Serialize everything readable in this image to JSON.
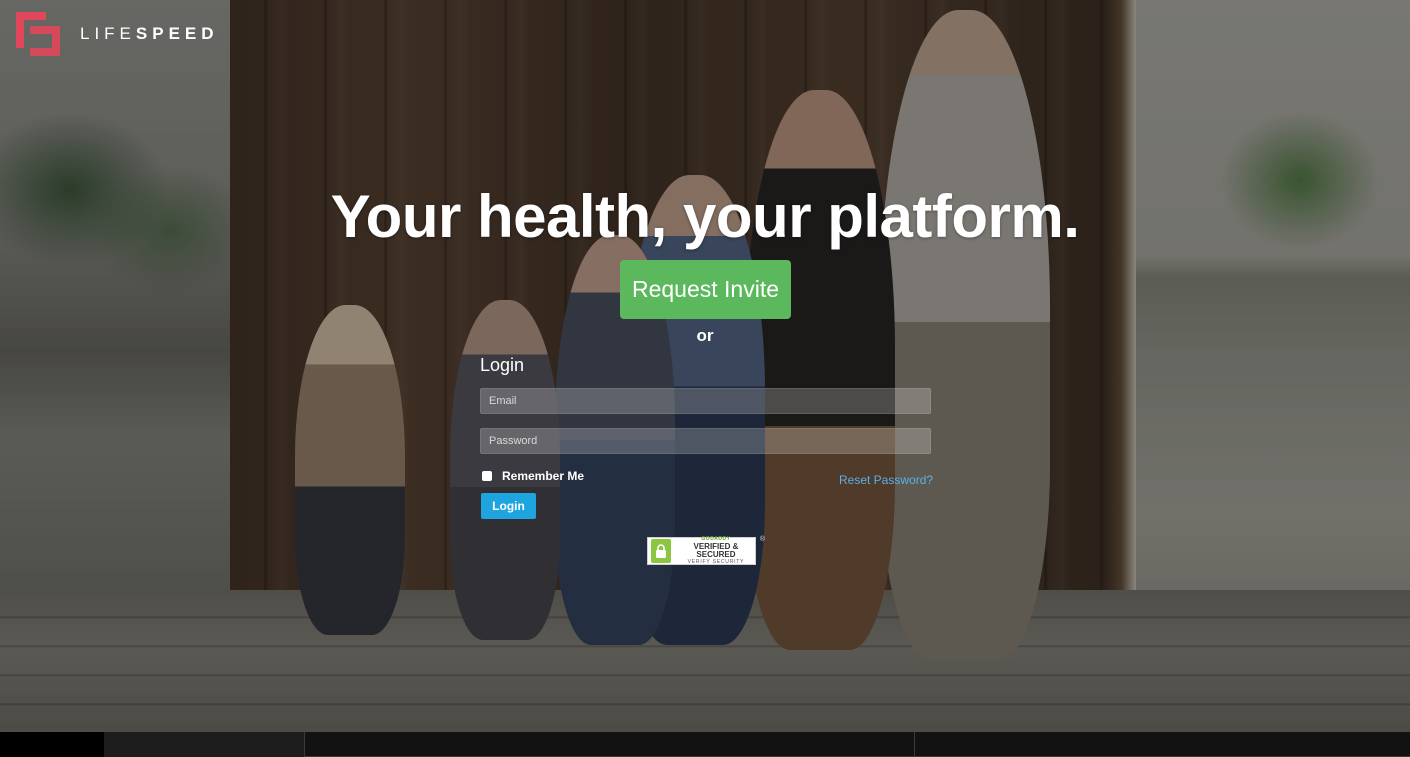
{
  "brand": {
    "name_light": "LIFE",
    "name_bold": "SPEED",
    "accent_color": "#e0475a"
  },
  "hero": {
    "headline": "Your health, your platform.",
    "request_invite_label": "Request Invite",
    "or_text": "or"
  },
  "login": {
    "title": "Login",
    "email_placeholder": "Email",
    "password_placeholder": "Password",
    "remember_label": "Remember Me",
    "reset_label": "Reset Password?",
    "submit_label": "Login"
  },
  "seal": {
    "brand": "GODADDY",
    "main": "VERIFIED & SECURED",
    "verify": "VERIFY SECURITY",
    "icon": "lock-icon"
  },
  "colors": {
    "invite_button": "#5cb85c",
    "login_button": "#1ea4df",
    "reset_link": "#5bb0e8"
  }
}
